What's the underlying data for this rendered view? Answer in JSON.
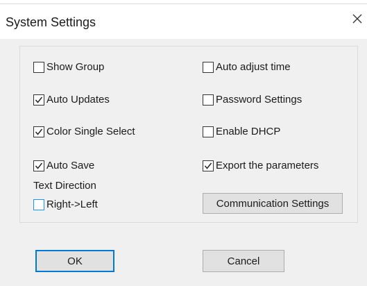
{
  "window": {
    "title": "System Settings"
  },
  "checkboxes_left": [
    {
      "label": "Show Group",
      "checked": false
    },
    {
      "label": "Auto Updates",
      "checked": true
    },
    {
      "label": "Color Single Select",
      "checked": true
    },
    {
      "label": "Auto Save",
      "checked": true
    }
  ],
  "checkboxes_right": [
    {
      "label": "Auto adjust time",
      "checked": false
    },
    {
      "label": "Password Settings",
      "checked": false
    },
    {
      "label": "Enable DHCP",
      "checked": false
    },
    {
      "label": "Export the parameters",
      "checked": true
    }
  ],
  "text_direction": {
    "label": "Text Direction",
    "option_label": "Right->Left",
    "checked": false
  },
  "buttons": {
    "communication": "Communication Settings",
    "ok": "OK",
    "cancel": "Cancel"
  },
  "colors": {
    "focus_blue": "#1e90ff",
    "default_button_border": "#0078d7"
  }
}
